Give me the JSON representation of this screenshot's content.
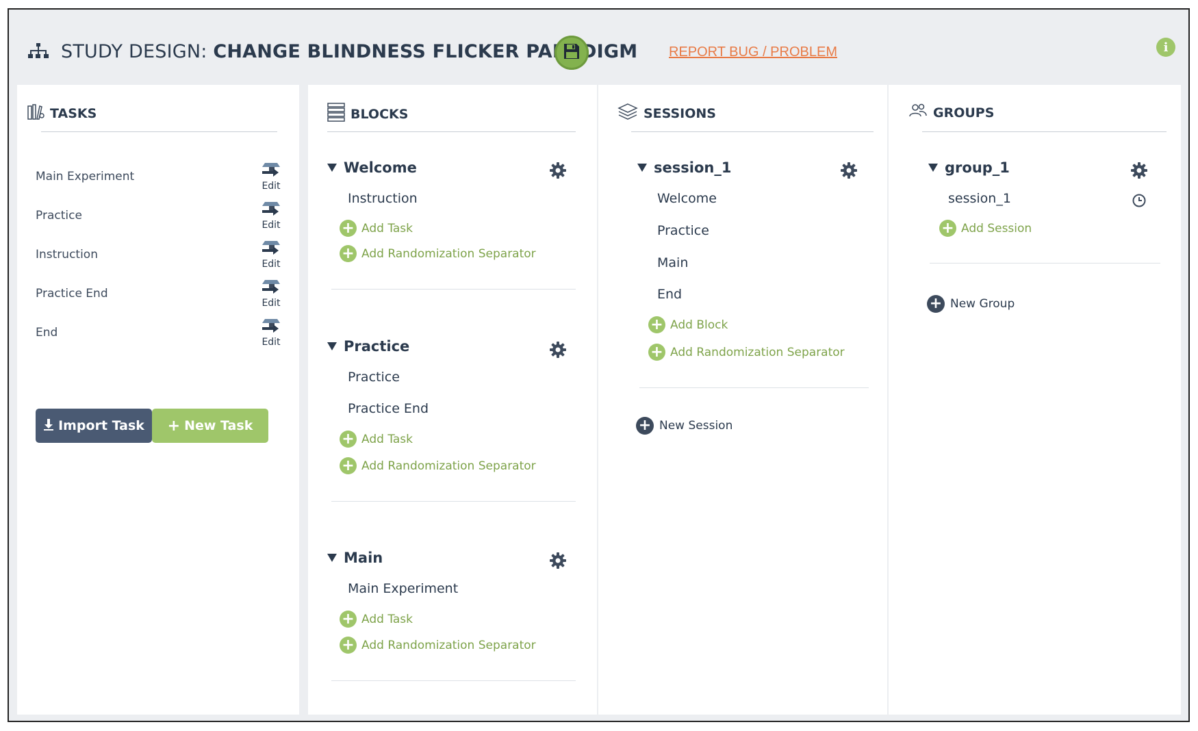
{
  "header": {
    "title_prefix": "STUDY DESIGN: ",
    "title_name": "CHANGE BLINDNESS FLICKER PARADIGM",
    "report_link": "REPORT BUG / PROBLEM",
    "info_label": "i"
  },
  "tasks": {
    "heading": "TASKS",
    "items": [
      "Main Experiment",
      "Practice",
      "Instruction",
      "Practice End",
      "End"
    ],
    "edit_label": "Edit",
    "import_button": "Import Task",
    "new_button": "New Task"
  },
  "blocks": {
    "heading": "BLOCKS",
    "add_task_label": "Add Task",
    "add_separator_label": "Add Randomization Separator",
    "groups": [
      {
        "name": "Welcome",
        "items": [
          "Instruction"
        ]
      },
      {
        "name": "Practice",
        "items": [
          "Practice",
          "Practice End"
        ]
      },
      {
        "name": "Main",
        "items": [
          "Main Experiment"
        ]
      }
    ]
  },
  "sessions": {
    "heading": "SESSIONS",
    "session_name": "session_1",
    "items": [
      "Welcome",
      "Practice",
      "Main",
      "End"
    ],
    "add_block_label": "Add Block",
    "add_separator_label": "Add Randomization Separator",
    "new_session_label": "New Session"
  },
  "groups": {
    "heading": "GROUPS",
    "group_name": "group_1",
    "session_item": "session_1",
    "add_session_label": "Add Session",
    "new_group_label": "New Group"
  },
  "colors": {
    "accent_green": "#9fc66a",
    "dark_navy": "#4a5a73",
    "report_orange": "#e87a45",
    "background": "#eceef1"
  }
}
